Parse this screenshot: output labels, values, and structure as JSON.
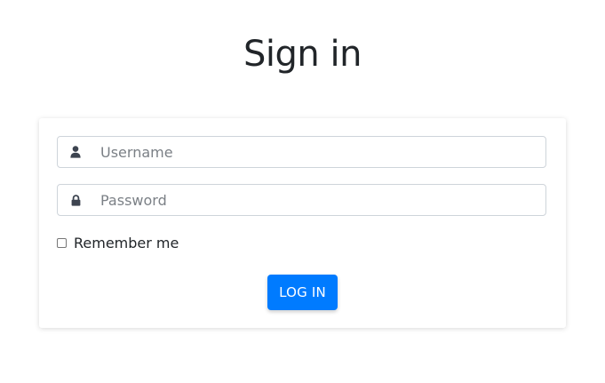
{
  "page": {
    "title": "Sign in"
  },
  "form": {
    "username": {
      "placeholder": "Username",
      "value": "",
      "icon": "user-icon"
    },
    "password": {
      "placeholder": "Password",
      "value": "",
      "icon": "lock-icon"
    },
    "remember": {
      "label": "Remember me",
      "checked": false
    },
    "submit_label": "LOG IN"
  },
  "colors": {
    "accent": "#007bff",
    "icon": "#3d4450",
    "text": "#212529"
  }
}
